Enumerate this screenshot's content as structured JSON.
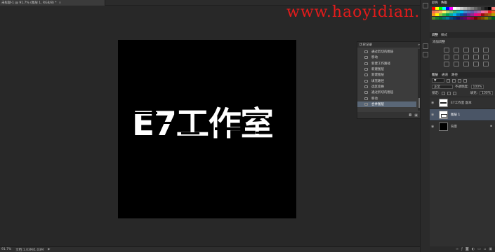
{
  "document": {
    "tab_title": "未标题-1 @ 91.7% (图层 1, RGB/8) *",
    "close_glyph": "×",
    "canvas_text": "E7工作室",
    "canvas_bg": "#000000",
    "text_color": "#ffffff"
  },
  "watermark": {
    "text": "www.haoyidian.com",
    "color": "#e21b1b"
  },
  "history_panel": {
    "title": "历史记录",
    "collapse_glyph": "»",
    "menu_glyph": "≡",
    "items": [
      {
        "label": "通过剪切的图层"
      },
      {
        "label": "移动"
      },
      {
        "label": "新建工作路径"
      },
      {
        "label": "新建图层"
      },
      {
        "label": "新建图层"
      },
      {
        "label": "填充路径"
      },
      {
        "label": "选区变换"
      },
      {
        "label": "通过剪切的图层"
      },
      {
        "label": "移动"
      },
      {
        "label": "合并图层",
        "selected": true
      }
    ],
    "footer_icons": [
      "camera-icon",
      "trash-icon"
    ]
  },
  "right_panels": {
    "swatch_tabs": [
      "颜色",
      "色板"
    ],
    "swatch_colors": [
      "#ff0000",
      "#ffff00",
      "#00ff00",
      "#00ffff",
      "#0000ff",
      "#ff00ff",
      "#ffffff",
      "#e6e6e6",
      "#cccccc",
      "#b3b3b3",
      "#999999",
      "#808080",
      "#666666",
      "#4d4d4d",
      "#333333",
      "#1a1a1a",
      "#000000",
      "#ff8080",
      "#f26c4f",
      "#f68e55",
      "#fbaf5c",
      "#fff467",
      "#acd372",
      "#7dc473",
      "#39b778",
      "#16bcb4",
      "#00bff3",
      "#438ccb",
      "#5573b7",
      "#5e5ca7",
      "#855fa8",
      "#a763a9",
      "#ef6ea8",
      "#f16d7e",
      "#ed1c24",
      "#f26522",
      "#f7941d",
      "#fff200",
      "#8dc63f",
      "#39b54a",
      "#00a651",
      "#00a99d",
      "#00aeef",
      "#0072bc",
      "#0054a5",
      "#2e3192",
      "#662d91",
      "#92278f",
      "#ec008c",
      "#ed145b",
      "#9e0b0f",
      "#a0410d",
      "#a3620a",
      "#aba000",
      "#598527",
      "#1a7b30",
      "#007236",
      "#00746b",
      "#0076a4",
      "#004a80",
      "#003471",
      "#1b1464",
      "#440e62",
      "#630460",
      "#9e005d",
      "#9e0039",
      "#790000",
      "#7b2e00",
      "#7d4900",
      "#827b00",
      "#406618",
      "#005e20"
    ],
    "adjust_tabs": [
      "调整",
      "样式"
    ],
    "adjust_title": "添加调整",
    "layers_tabs": [
      "图层",
      "通道",
      "路径"
    ],
    "blend_mode": "正常",
    "opacity_label": "不透明度:",
    "opacity_value": "100%",
    "lock_label": "锁定:",
    "fill_label": "填充:",
    "fill_value": "100%",
    "layers": [
      {
        "name": "E7工作室 副本",
        "type": "text",
        "visible": true,
        "selected": false
      },
      {
        "name": "图层 1",
        "type": "shape",
        "visible": true,
        "selected": true
      },
      {
        "name": "背景",
        "type": "fill",
        "visible": true,
        "selected": false,
        "locked": true
      }
    ]
  },
  "status_bar": {
    "zoom": "91.7%",
    "doc_info": "文档:1.03M/1.03M",
    "arrow": "▶"
  }
}
